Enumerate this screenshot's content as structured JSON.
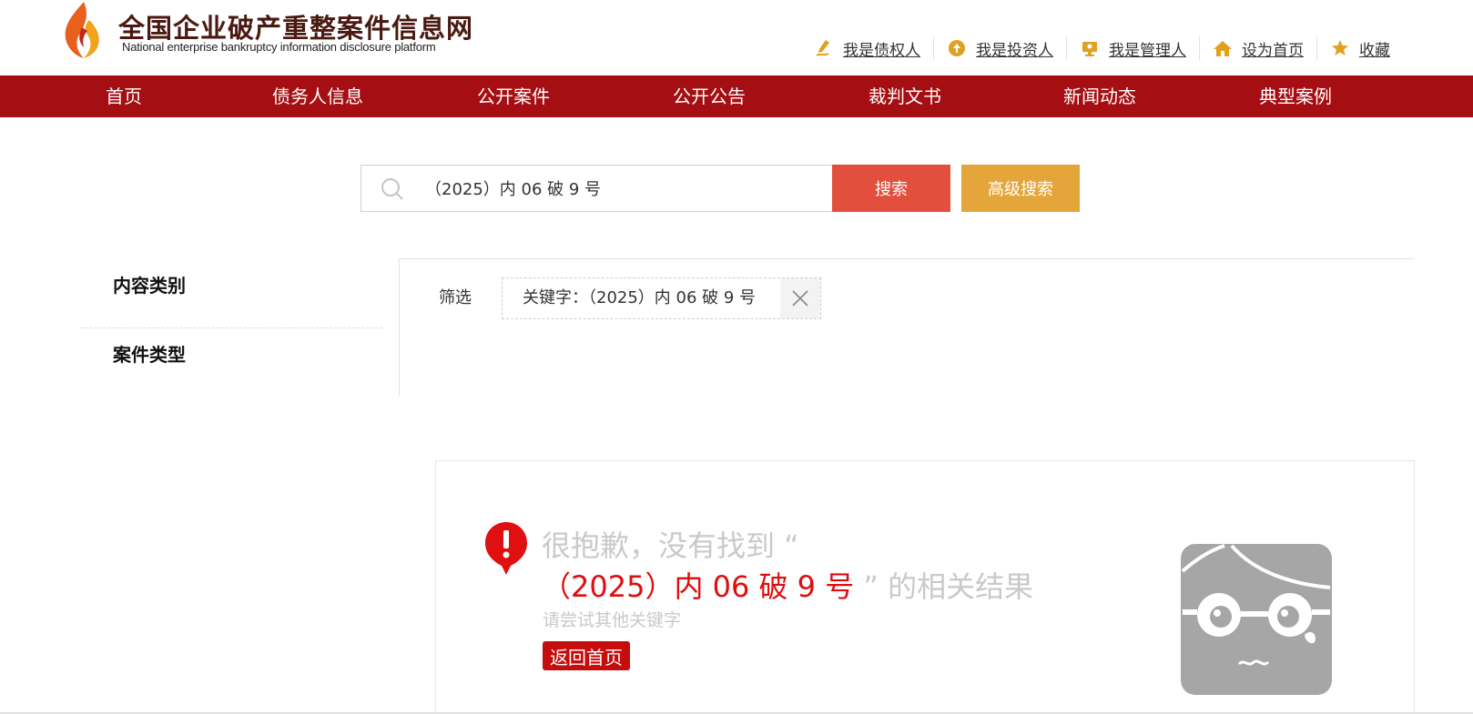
{
  "header": {
    "title": "全国企业破产重整案件信息网",
    "subtitle": "National enterprise bankruptcy  information disclosure platform",
    "links": [
      {
        "label": "我是债权人",
        "icon": "creditor-icon"
      },
      {
        "label": "我是投资人",
        "icon": "investor-icon"
      },
      {
        "label": "我是管理人",
        "icon": "manager-icon"
      },
      {
        "label": "设为首页",
        "icon": "home-icon"
      },
      {
        "label": "收藏",
        "icon": "star-icon"
      }
    ]
  },
  "nav": {
    "items": [
      "首页",
      "债务人信息",
      "公开案件",
      "公开公告",
      "裁判文书",
      "新闻动态",
      "典型案例"
    ]
  },
  "search": {
    "value": "（2025）内 06 破 9 号",
    "search_label": "搜索",
    "advanced_label": "高级搜索"
  },
  "sidebar": {
    "sections": [
      "内容类别",
      "案件类型"
    ]
  },
  "filter": {
    "label": "筛选",
    "tag": "关键字：（2025）内 06 破 9 号"
  },
  "result": {
    "line1": "很抱歉，没有找到 “",
    "keyword": "（2025）内 06 破 9 号",
    "line2_after": " ” 的相关结果",
    "hint": "请尝试其他关键字",
    "home_button": "返回首页"
  },
  "colors": {
    "nav_bg": "#a50e12",
    "search_btn": "#e24f3c",
    "advanced_btn": "#e4a63b",
    "keyword": "#e00d0d",
    "home_btn": "#c70c0c"
  }
}
